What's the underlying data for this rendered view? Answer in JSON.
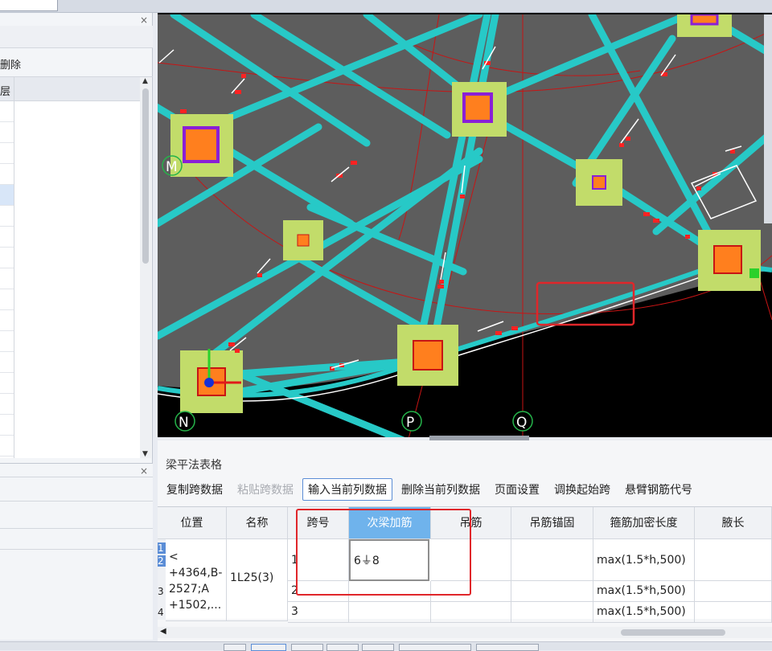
{
  "left_panel": {
    "delete_label": "删除",
    "layer_header": "层",
    "close_glyph": "×"
  },
  "canvas": {
    "axis_labels": [
      "M",
      "N",
      "P",
      "Q"
    ],
    "colors": {
      "background": "#5d5d5d",
      "void": "#000000",
      "beam": "#27c9c7",
      "column": "#ff7f1e",
      "pad": "#c2dc6a",
      "axis": "#c81414",
      "highlight": "#e0262a"
    }
  },
  "bottom_panel": {
    "title": "梁平法表格",
    "toolbar": {
      "copy_span": "复制跨数据",
      "paste_span": "粘贴跨数据",
      "input_column": "输入当前列数据",
      "delete_column": "删除当前列数据",
      "page_settings": "页面设置",
      "swap_start_span": "调换起始跨",
      "cantilever_code": "悬臂钢筋代号"
    },
    "columns": {
      "position": "位置",
      "name": "名称",
      "span_no": "跨号",
      "secondary_beam_rebar": "次梁加筋",
      "hanger_rebar": "吊筋",
      "hanger_anchor": "吊筋锚固",
      "stirrup_dense_length": "箍筋加密长度",
      "haunch_length": "腋长"
    },
    "row_indices": [
      "1",
      "2",
      "3",
      "4"
    ],
    "rows": {
      "position_value": "<\n+4364,B-\n2527;A\n+1502,...",
      "name_value": "1L25(3)",
      "spans": [
        {
          "span": "1",
          "secondary": "6⏚8",
          "stirrup": "max(1.5*h,500)"
        },
        {
          "span": "2",
          "secondary": "",
          "stirrup": "max(1.5*h,500)"
        },
        {
          "span": "3",
          "secondary": "",
          "stirrup": "max(1.5*h,500)"
        }
      ]
    }
  }
}
